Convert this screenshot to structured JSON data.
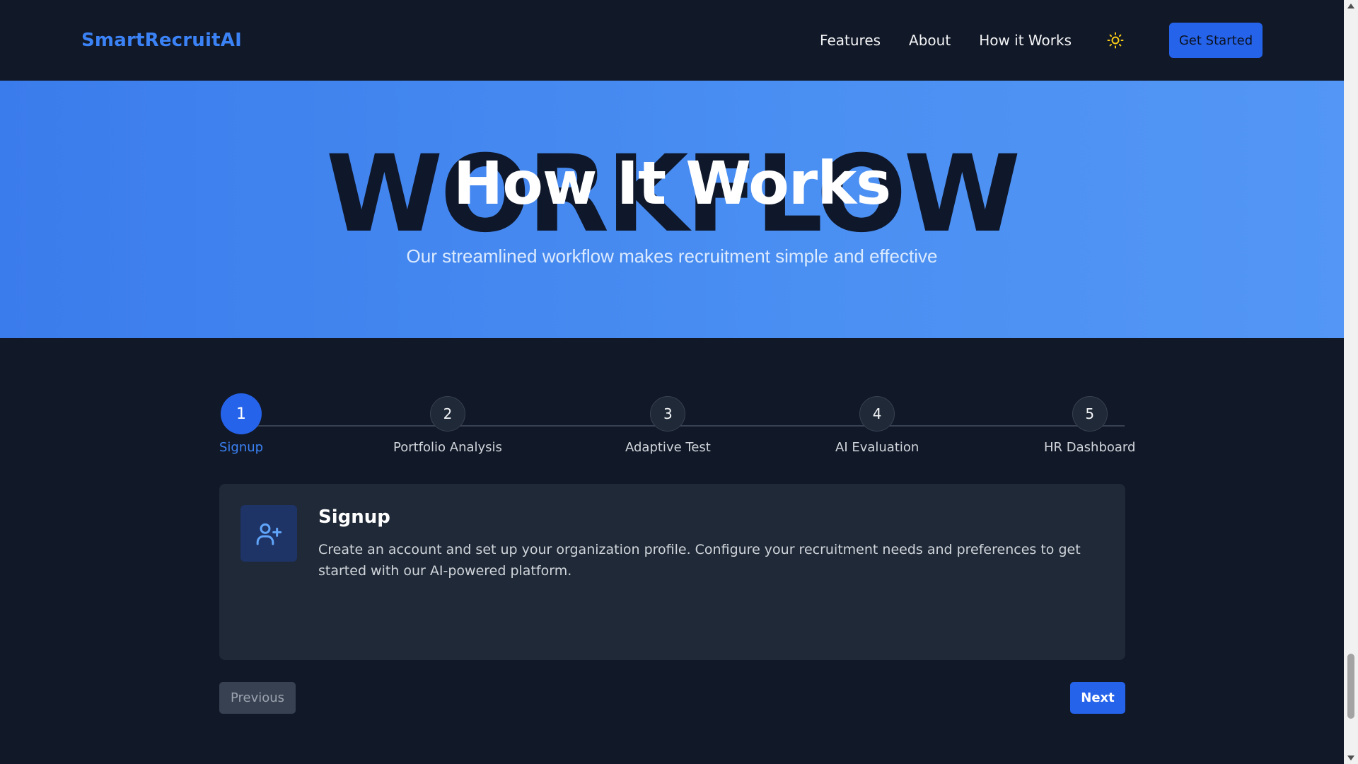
{
  "navbar": {
    "brand": "SmartRecruitAI",
    "links": [
      "Features",
      "About",
      "How it Works"
    ],
    "theme_icon": "sun-icon",
    "cta_label": "Get Started"
  },
  "hero": {
    "background_word": "WORKFLOW",
    "title": "How It Works",
    "subtitle": "Our streamlined workflow makes recruitment simple and effective"
  },
  "stepper": {
    "active_index": 0,
    "steps": [
      {
        "number": "1",
        "label": "Signup"
      },
      {
        "number": "2",
        "label": "Portfolio Analysis"
      },
      {
        "number": "3",
        "label": "Adaptive Test"
      },
      {
        "number": "4",
        "label": "AI Evaluation"
      },
      {
        "number": "5",
        "label": "HR Dashboard"
      }
    ]
  },
  "card": {
    "icon": "user-plus-icon",
    "title": "Signup",
    "text": "Create an account and set up your organization profile. Configure your recruitment needs and preferences to get started with our AI-powered platform."
  },
  "controls": {
    "previous_label": "Previous",
    "next_label": "Next"
  },
  "colors": {
    "accent": "#2563eb",
    "brand": "#3b82f6",
    "background": "#111827",
    "card": "#1f2937",
    "theme_icon": "#facc15"
  }
}
